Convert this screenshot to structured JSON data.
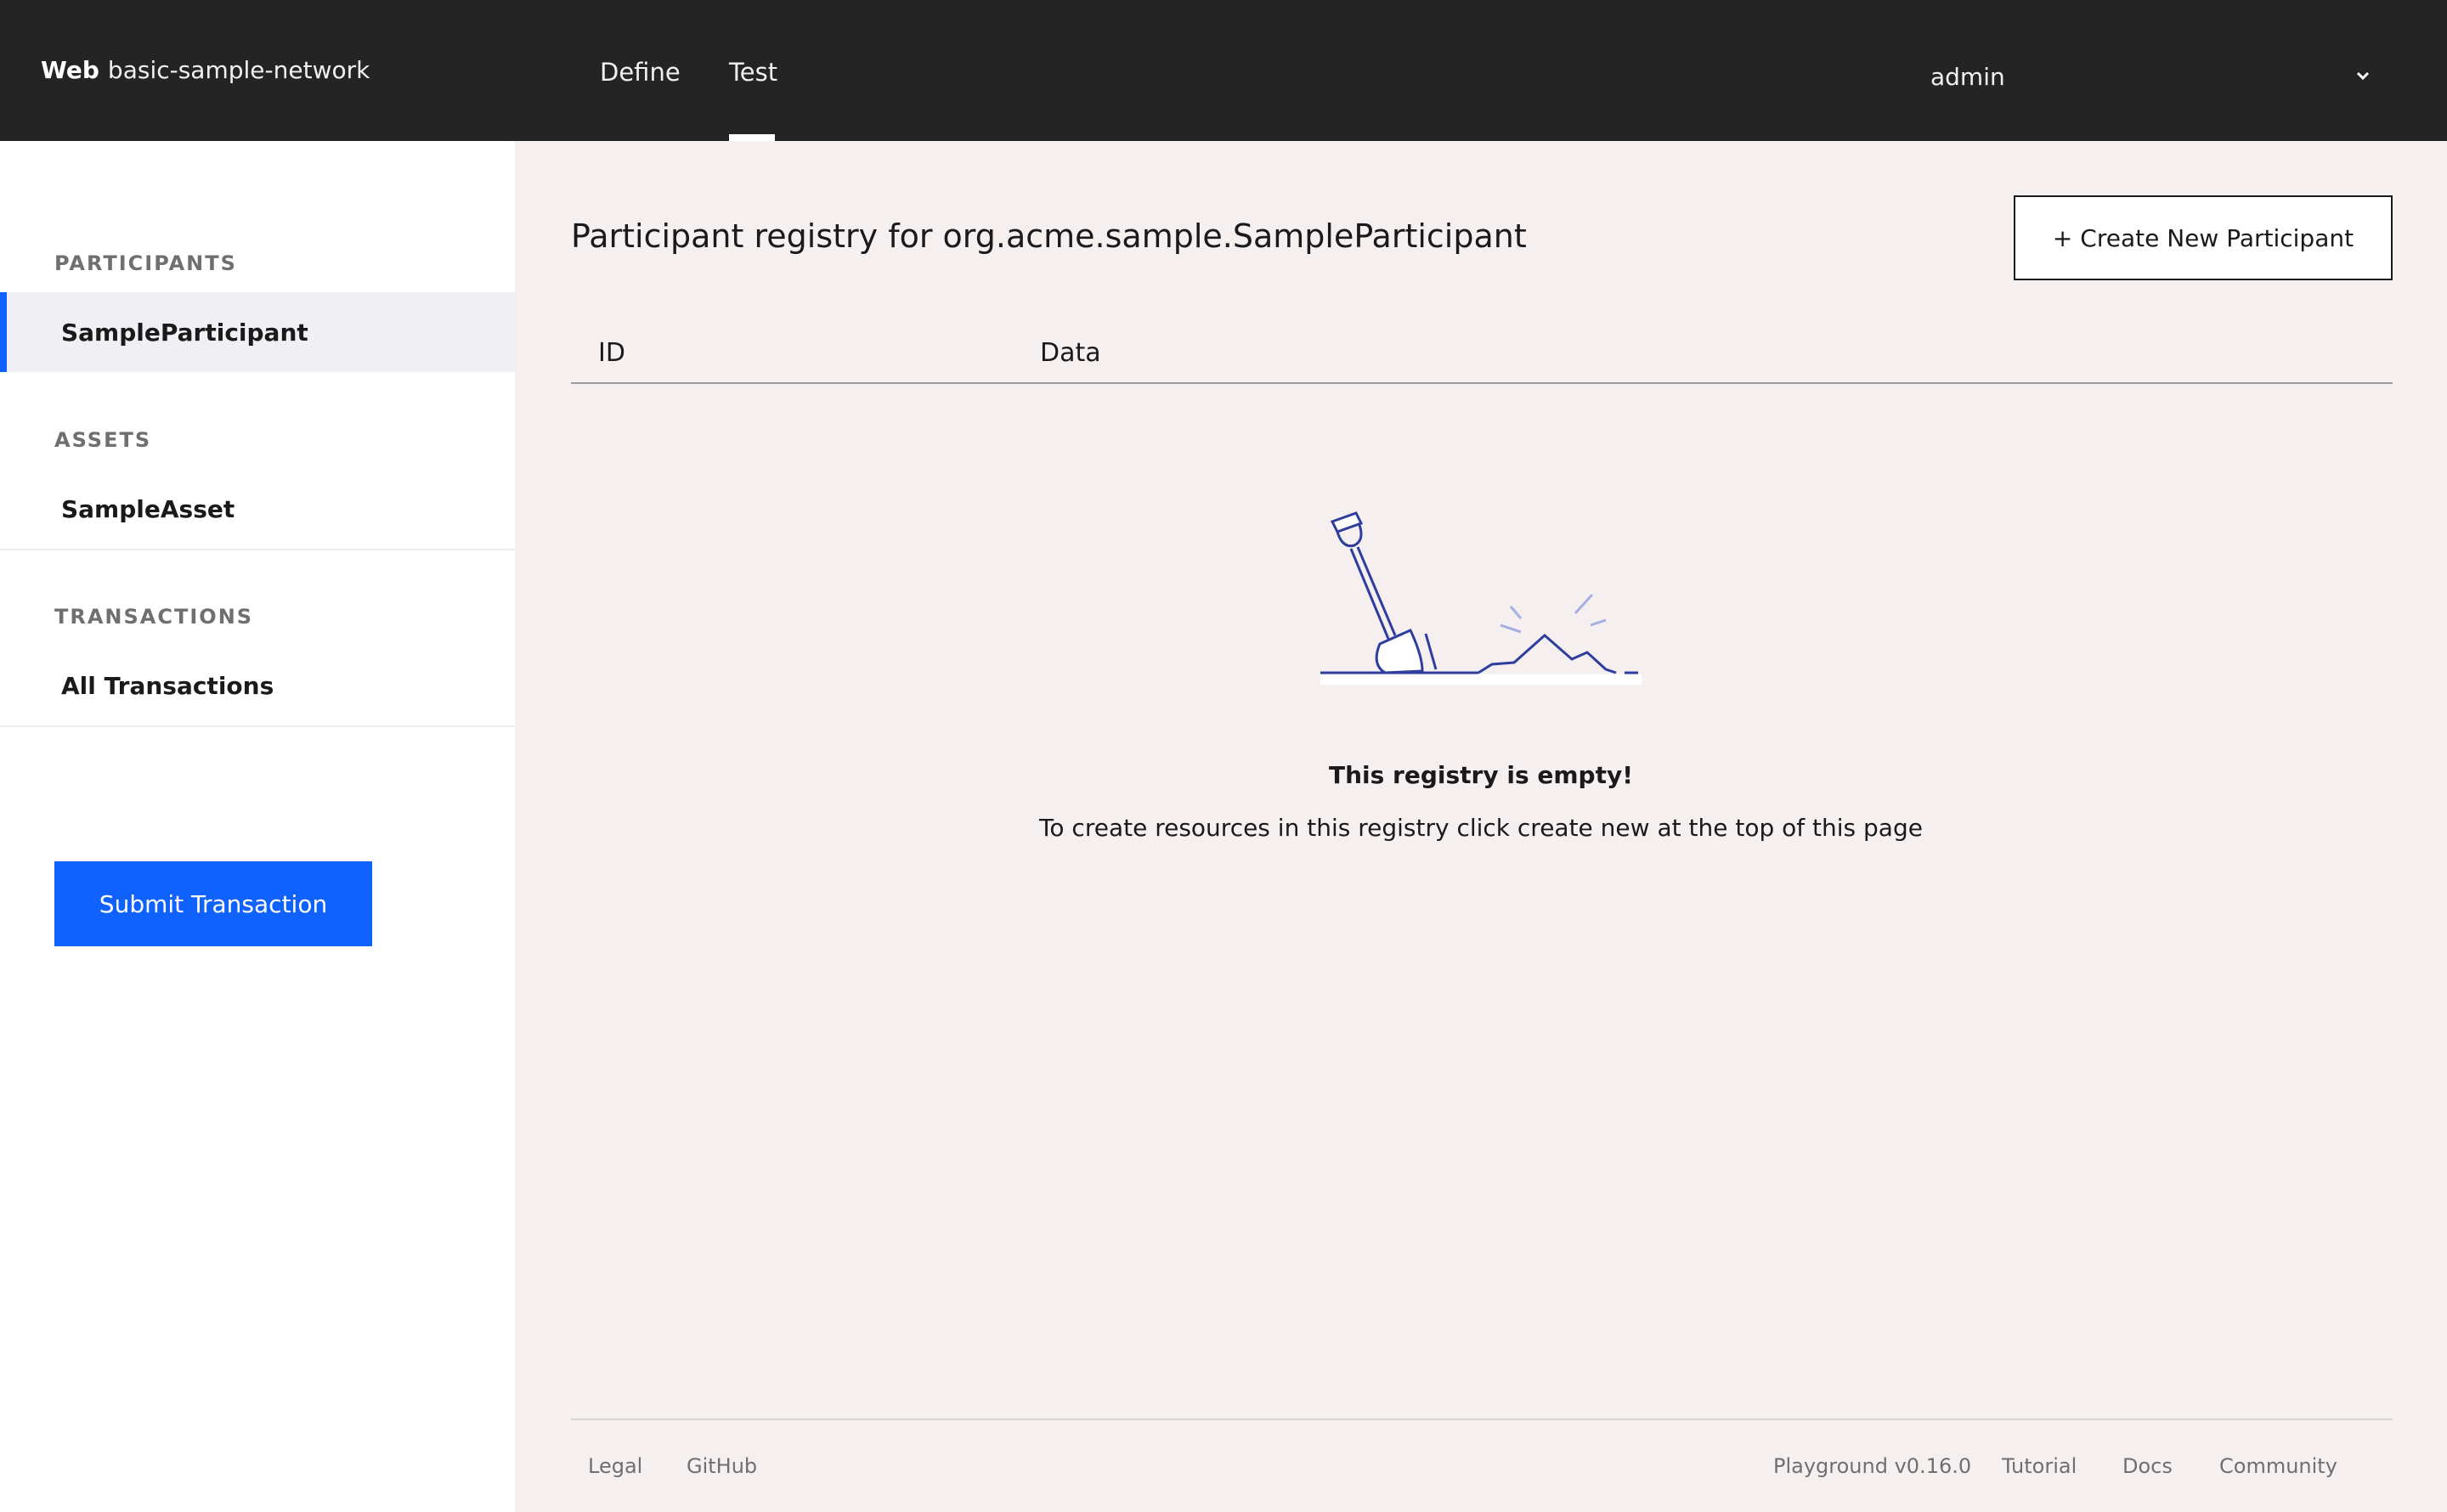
{
  "header": {
    "brand_strong": "Web",
    "brand_name": "basic-sample-network",
    "tabs": [
      {
        "label": "Define"
      },
      {
        "label": "Test"
      }
    ],
    "user": "admin"
  },
  "sidebar": {
    "sections": [
      {
        "title": "PARTICIPANTS",
        "items": [
          {
            "label": "SampleParticipant",
            "active": true
          }
        ]
      },
      {
        "title": "ASSETS",
        "items": [
          {
            "label": "SampleAsset"
          }
        ]
      },
      {
        "title": "TRANSACTIONS",
        "items": [
          {
            "label": "All Transactions"
          }
        ]
      }
    ],
    "submit_label": "Submit Transaction"
  },
  "main": {
    "title": "Participant registry for org.acme.sample.SampleParticipant",
    "create_label": "+ Create New Participant",
    "columns": [
      "ID",
      "Data"
    ],
    "empty_title": "This registry is empty!",
    "empty_desc": "To create resources in this registry click create new at the top of this page"
  },
  "footer": {
    "left": [
      "Legal",
      "GitHub"
    ],
    "right": [
      "Playground v0.16.0",
      "Tutorial",
      "Docs",
      "Community"
    ]
  },
  "colors": {
    "topbar": "#242424",
    "accent": "#0f62fe",
    "background": "#f5f0ef",
    "illustration": "#2f3e9e"
  }
}
